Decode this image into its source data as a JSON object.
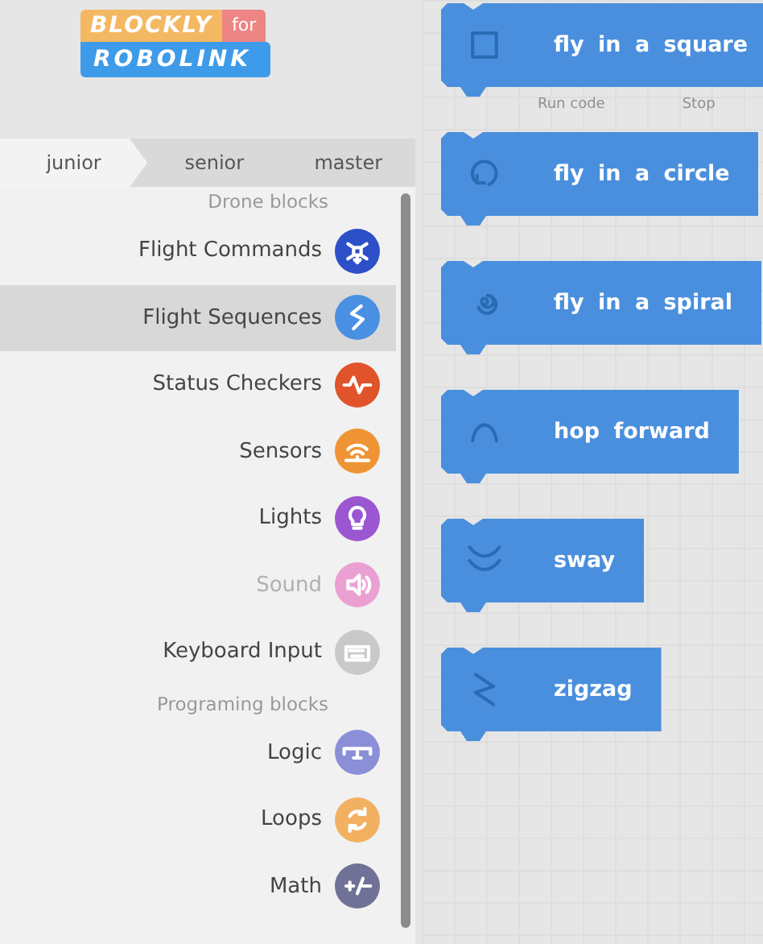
{
  "logo": {
    "line_1": "BLOCKLY",
    "tag": "for",
    "line_2": "ROBOLINK"
  },
  "tabs": [
    {
      "label": "junior",
      "selected": true
    },
    {
      "label": "senior",
      "selected": false
    },
    {
      "label": "master",
      "selected": false
    }
  ],
  "categories": [
    {
      "kind": "header",
      "label": "Drone blocks"
    },
    {
      "kind": "item",
      "label": "Flight Commands",
      "color": "#2d4fc8",
      "selected": false,
      "disabled": false
    },
    {
      "kind": "item",
      "label": "Flight Sequences",
      "color": "#4a90e2",
      "selected": true,
      "disabled": false
    },
    {
      "kind": "item",
      "label": "Status Checkers",
      "color": "#e0532b",
      "selected": false,
      "disabled": false
    },
    {
      "kind": "item",
      "label": "Sensors",
      "color": "#ef9434",
      "selected": false,
      "disabled": false
    },
    {
      "kind": "item",
      "label": "Lights",
      "color": "#9b56d2",
      "selected": false,
      "disabled": false
    },
    {
      "kind": "item",
      "label": "Sound",
      "color": "#eaa0d2",
      "selected": false,
      "disabled": true
    },
    {
      "kind": "item",
      "label": "Keyboard Input",
      "color": "#c9c9c9",
      "selected": false,
      "disabled": false
    },
    {
      "kind": "header",
      "label": "Programing blocks"
    },
    {
      "kind": "item",
      "label": "Logic",
      "color": "#8a8fd8",
      "selected": false,
      "disabled": false
    },
    {
      "kind": "item",
      "label": "Loops",
      "color": "#f2b061",
      "selected": false,
      "disabled": false
    },
    {
      "kind": "item",
      "label": "Math",
      "color": "#6f7196",
      "selected": false,
      "disabled": false
    }
  ],
  "workspace": {
    "blocks": [
      {
        "label": "fly in a square"
      },
      {
        "label": "fly in a circle"
      },
      {
        "label": "fly in a spiral"
      },
      {
        "label": "hop forward"
      },
      {
        "label": "sway"
      },
      {
        "label": "zigzag"
      }
    ],
    "controls": [
      "Run code",
      "Stop"
    ]
  }
}
